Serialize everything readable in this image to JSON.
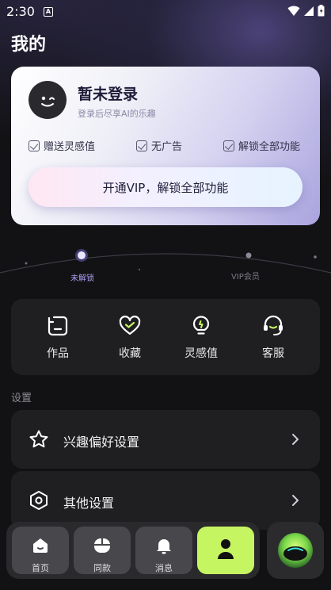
{
  "status_bar": {
    "time": "2:30",
    "notif_badge": "A"
  },
  "page": {
    "title": "我的"
  },
  "profile": {
    "name": "暂未登录",
    "subtitle": "登录后尽享AI的乐趣",
    "perks": [
      "赠送灵感值",
      "无广告",
      "解锁全部功能"
    ],
    "vip_button": "开通VIP，解锁全部功能"
  },
  "progress": {
    "current_label": "未解锁",
    "next_label": "VIP会员"
  },
  "quick_actions": [
    {
      "label": "作品",
      "icon": "works-icon"
    },
    {
      "label": "收藏",
      "icon": "heart-icon"
    },
    {
      "label": "灵感值",
      "icon": "lightbulb-icon"
    },
    {
      "label": "客服",
      "icon": "headset-icon"
    }
  ],
  "settings": {
    "section_label": "设置",
    "items": [
      {
        "label": "兴趣偏好设置",
        "icon": "star-icon"
      },
      {
        "label": "其他设置",
        "icon": "hexagon-settings-icon"
      }
    ]
  },
  "bottom_nav": {
    "items": [
      {
        "label": "首页",
        "icon": "home-icon"
      },
      {
        "label": "同款",
        "icon": "mouse-icon"
      },
      {
        "label": "消息",
        "icon": "bell-icon"
      },
      {
        "label": "",
        "icon": "person-icon",
        "active": true
      }
    ],
    "ai_button_icon": "ai-orb-icon"
  },
  "colors": {
    "background": "#121214",
    "card_surface": "#1f1f22",
    "accent_green": "#c6f562",
    "card_gradient_end": "#a9a4de"
  }
}
